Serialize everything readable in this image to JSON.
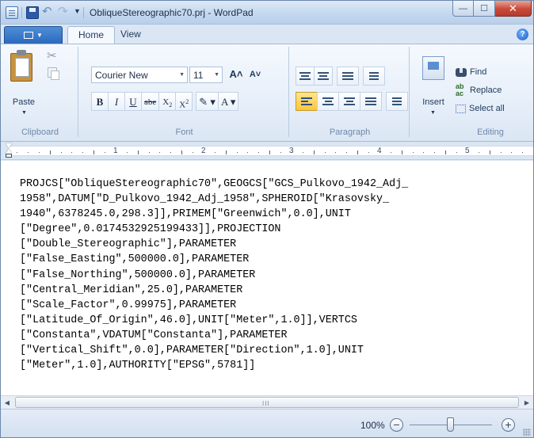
{
  "window": {
    "title": "ObliqueStereographic70.prj - WordPad"
  },
  "titlebar_buttons": {
    "minimize_glyph": "—",
    "maximize_glyph": "☐",
    "close_glyph": "✕"
  },
  "ribbon": {
    "tabs": {
      "home": "Home",
      "view": "View"
    },
    "help_glyph": "?",
    "clipboard": {
      "paste_label": "Paste",
      "group_label": "Clipboard"
    },
    "font": {
      "font_name": "Courier New",
      "font_size": "11",
      "grow_label": "A˄",
      "shrink_label": "A˅",
      "bold": "B",
      "italic": "I",
      "underline": "U",
      "strike": "abe",
      "subscript_base": "X",
      "subscript_mark": "2",
      "superscript_base": "X",
      "superscript_mark": "2",
      "highlight_glyph": "✎",
      "color_glyph": "A",
      "group_label": "Font"
    },
    "paragraph": {
      "group_label": "Paragraph"
    },
    "editing": {
      "insert_label": "Insert",
      "find_label": "Find",
      "replace_label": "Replace",
      "select_all_label": "Select all",
      "group_label": "Editing"
    }
  },
  "ruler": {
    "numbers": [
      "1",
      "2",
      "3",
      "4",
      "5"
    ]
  },
  "document": {
    "lines": [
      "PROJCS[\"ObliqueStereographic70\",GEOGCS[\"GCS_Pulkovo_1942_Adj_",
      "1958\",DATUM[\"D_Pulkovo_1942_Adj_1958\",SPHEROID[\"Krasovsky_",
      "1940\",6378245.0,298.3]],PRIMEM[\"Greenwich\",0.0],UNIT",
      "[\"Degree\",0.0174532925199433]],PROJECTION",
      "[\"Double_Stereographic\"],PARAMETER",
      "[\"False_Easting\",500000.0],PARAMETER",
      "[\"False_Northing\",500000.0],PARAMETER",
      "[\"Central_Meridian\",25.0],PARAMETER",
      "[\"Scale_Factor\",0.99975],PARAMETER",
      "[\"Latitude_Of_Origin\",46.0],UNIT[\"Meter\",1.0]],VERTCS",
      "[\"Constanta\",VDATUM[\"Constanta\"],PARAMETER",
      "[\"Vertical_Shift\",0.0],PARAMETER[\"Direction\",1.0],UNIT",
      "[\"Meter\",1.0],AUTHORITY[\"EPSG\",5781]]"
    ]
  },
  "status_bar": {
    "zoom_level": "100%",
    "zoom_out_glyph": "−",
    "zoom_in_glyph": "+"
  },
  "scrollbar": {
    "grip_glyph": "III"
  }
}
